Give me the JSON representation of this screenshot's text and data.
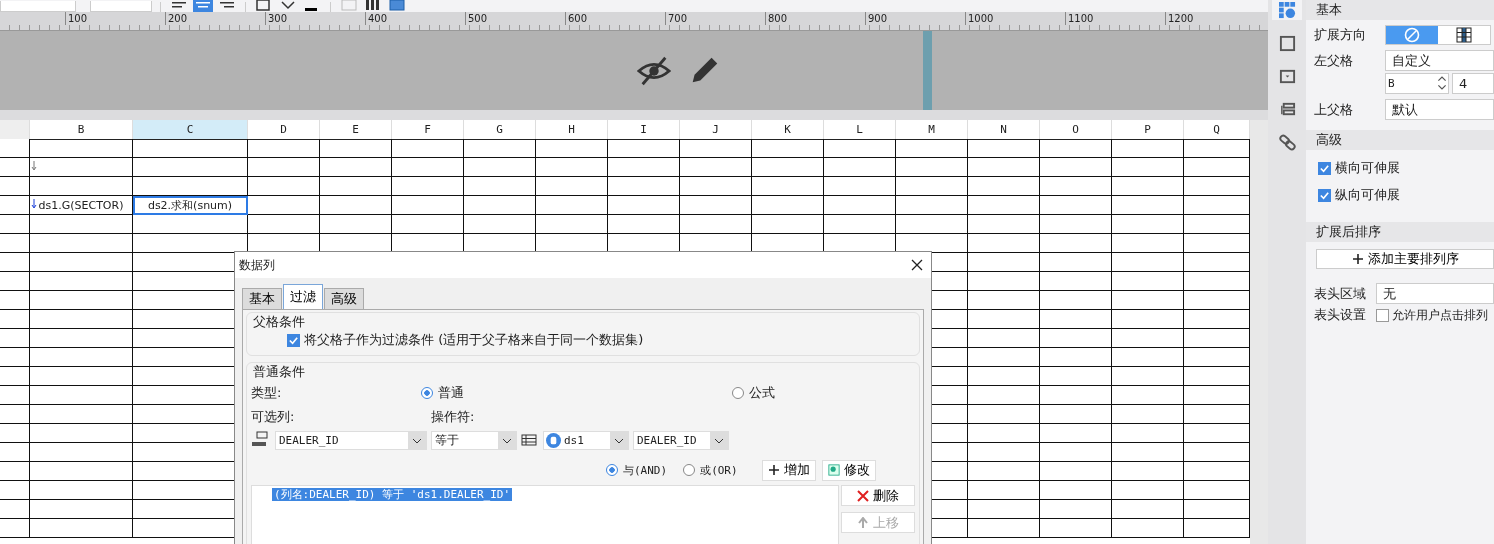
{
  "toolbar": {
    "align": [
      {
        "selected": false
      },
      {
        "selected": true
      },
      {
        "selected": false
      }
    ]
  },
  "ruler": {
    "labels": [
      "100",
      "200",
      "300",
      "400",
      "500",
      "600",
      "700",
      "800",
      "900",
      "1000",
      "1100",
      "1200"
    ]
  },
  "grid": {
    "columns": [
      {
        "label": "B",
        "selected": false
      },
      {
        "label": "C",
        "selected": true
      },
      {
        "label": "D",
        "selected": false
      },
      {
        "label": "E",
        "selected": false
      },
      {
        "label": "F",
        "selected": false
      },
      {
        "label": "G",
        "selected": false
      },
      {
        "label": "H",
        "selected": false
      },
      {
        "label": "I",
        "selected": false
      },
      {
        "label": "J",
        "selected": false
      },
      {
        "label": "K",
        "selected": false
      },
      {
        "label": "L",
        "selected": false
      },
      {
        "label": "M",
        "selected": false
      },
      {
        "label": "N",
        "selected": false
      },
      {
        "label": "O",
        "selected": false
      },
      {
        "label": "P",
        "selected": false
      },
      {
        "label": "Q",
        "selected": false
      }
    ],
    "formula_cells": [
      {
        "text": "ds1.G(SECTOR)",
        "selected": false
      },
      {
        "text": "ds2.求和(snum)",
        "selected": true
      }
    ]
  },
  "dialog": {
    "title": "数据列",
    "tabs": [
      {
        "label": "基本",
        "selected": false
      },
      {
        "label": "过滤",
        "selected": true
      },
      {
        "label": "高级",
        "selected": false
      }
    ],
    "parent_group": {
      "title": "父格条件",
      "checkbox": {
        "label": "将父格子作为过滤条件 (适用于父子格来自于同一个数据集)",
        "checked": true
      }
    },
    "normal_group": {
      "title": "普通条件",
      "type_label": "类型:",
      "type_options": [
        {
          "label": "普通",
          "selected": true
        },
        {
          "label": "公式",
          "selected": false
        }
      ],
      "column_label": "可选列:",
      "operator_label": "操作符:",
      "column_value": "DEALER_ID",
      "operator_value": "等于",
      "dataset_value": "ds1",
      "field_value": "DEALER_ID",
      "logic_options": [
        {
          "label": "与(AND)",
          "selected": true
        },
        {
          "label": "或(OR)",
          "selected": false
        }
      ],
      "add_button": "增加",
      "edit_button": "修改",
      "conditions": [
        {
          "text": "(列名:DEALER_ID) 等于 'ds1.DEALER_ID'",
          "selected": true
        }
      ],
      "delete_button": {
        "label": "删除",
        "disabled": false
      },
      "move_up_button": {
        "label": "上移",
        "disabled": true
      }
    }
  },
  "panel": {
    "tabs": [
      {
        "kind": "attributes",
        "selected": true
      },
      {
        "kind": "border",
        "selected": false
      },
      {
        "kind": "widget",
        "selected": false
      },
      {
        "kind": "layout",
        "selected": false
      },
      {
        "kind": "link",
        "selected": false
      }
    ],
    "basic": {
      "title": "基本",
      "direction_label": "扩展方向",
      "direction_options": [
        {
          "kind": "none",
          "selected": true
        },
        {
          "kind": "grid",
          "selected": false
        }
      ],
      "left_parent_label": "左父格",
      "left_parent_value": "自定义",
      "left_parent_column": "B",
      "left_parent_row": "4",
      "top_parent_label": "上父格",
      "top_parent_value": "默认"
    },
    "advanced": {
      "title": "高级",
      "options": [
        {
          "label": "横向可伸展",
          "checked": true
        },
        {
          "label": "纵向可伸展",
          "checked": true
        }
      ]
    },
    "sort": {
      "title": "扩展后排序",
      "add_button": "添加主要排列序",
      "header_area_label": "表头区域",
      "header_area_value": "无",
      "header_setting_label": "表头设置",
      "header_setting_option": {
        "label": "允许用户点击排列",
        "checked": false
      }
    }
  }
}
